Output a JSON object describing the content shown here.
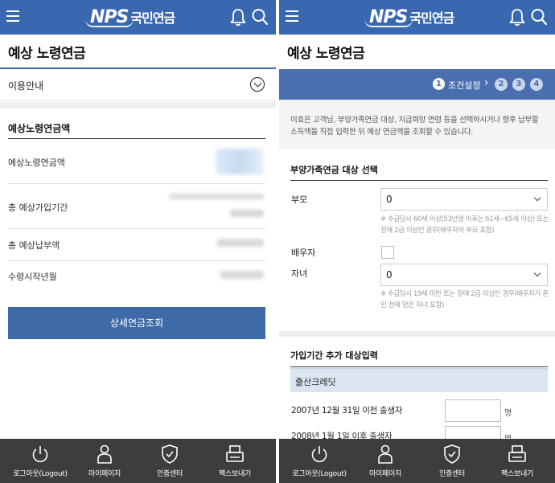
{
  "header": {
    "logo_mark": "NPS",
    "logo_text": "국민연금"
  },
  "page_title": "예상 노령연금",
  "left": {
    "guide_label": "이용안내",
    "section_title": "예상노령연금액",
    "rows": [
      {
        "label": "예상노령연금액"
      },
      {
        "label": "총 예상가입기간"
      },
      {
        "label": "총 예상납부액"
      },
      {
        "label": "수령시작년월"
      }
    ],
    "detail_button": "상세연금조회"
  },
  "right": {
    "steps": {
      "active_number": "1",
      "active_label": "조건설정",
      "others": [
        "2",
        "3",
        "4"
      ]
    },
    "intro_text": "이효은 고객님, 부양가족연금 대상, 지급희망 연령 등을 선택하시거나 향후 납부할 소득액을 직접 입력한 뒤 예상 연금액을 조회할 수 있습니다.",
    "dependents": {
      "title": "부양가족연금 대상 선택",
      "parents_label": "부모",
      "parents_value": "0",
      "parents_note": "※ 수급당시 60세 이상(53년생 이후는 61세~65세 이상) 또는 장애 2급 이상인 경우(배우자의 부모 포함)",
      "spouse_label": "배우자",
      "children_label": "자녀",
      "children_value": "0",
      "children_note": "※ 수급당시 19세 미만 또는 장애 2급 이상인 경우(배우자가 혼인 전에 얻은 자녀 포함)"
    },
    "extra": {
      "title": "가입기간 추가 대상입력",
      "credit_header": "출산크레딧",
      "birth_before_label": "2007년 12월 31일 이전 출생자",
      "birth_after_label": "2008년 1월 1일 이후 출생자",
      "unit": "명"
    }
  },
  "bottom_nav": [
    {
      "label": "로그아웃(Logout)",
      "icon": "power-icon"
    },
    {
      "label": "마이페이지",
      "icon": "person-icon"
    },
    {
      "label": "인증센터",
      "icon": "shield-icon"
    },
    {
      "label": "팩스보내기",
      "icon": "fax-icon"
    }
  ],
  "colors": {
    "header_blue": "#3a68b0",
    "step_blue": "#4a6fb0",
    "button_blue": "#3f6aa8",
    "nav_dark": "#3d3d3d"
  }
}
